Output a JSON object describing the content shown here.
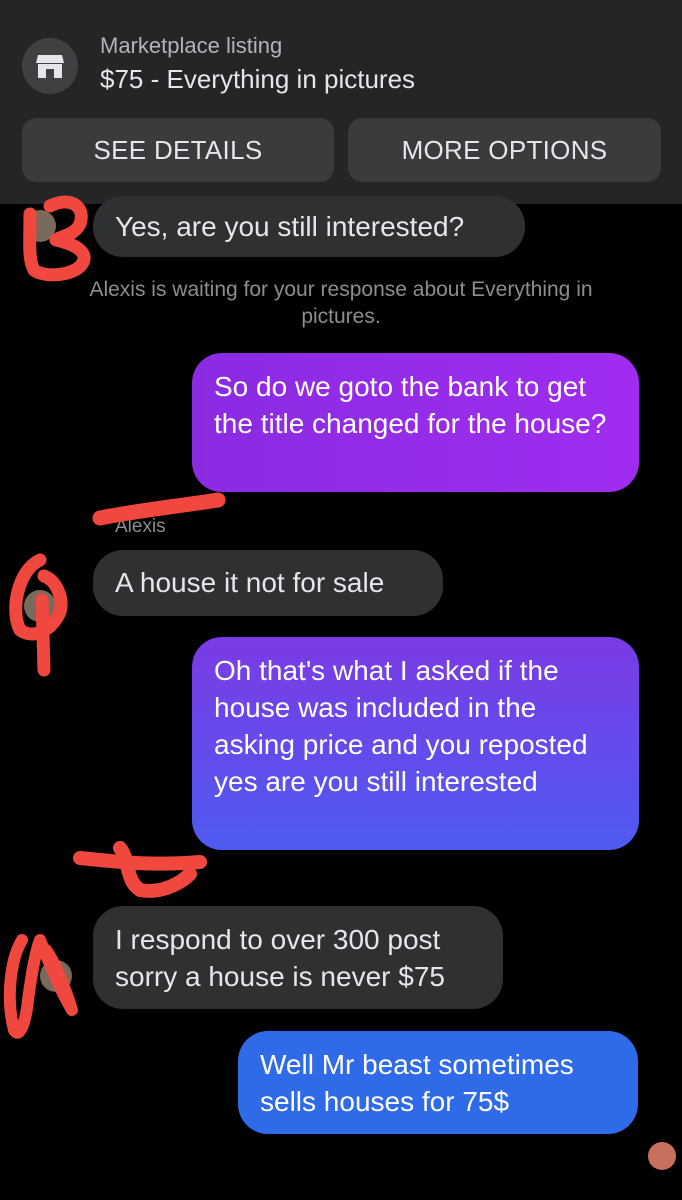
{
  "listing": {
    "label": "Marketplace listing",
    "title": "$75 - Everything in pictures",
    "icon": "store-icon"
  },
  "buttons": {
    "see_details": "SEE DETAILS",
    "more_options": "MORE OPTIONS"
  },
  "system_note": "Alexis is waiting for your response about Everything in pictures.",
  "sender_name": "Alexis",
  "messages": [
    {
      "direction": "incoming",
      "text": "Yes, are you still interested?"
    },
    {
      "direction": "outgoing",
      "text": "So do we goto the bank to get the title changed for the house?"
    },
    {
      "direction": "incoming",
      "text": "A house it not for sale"
    },
    {
      "direction": "outgoing",
      "text": "Oh that's what I asked if the house was included in the asking price and you reposted yes are you still interested"
    },
    {
      "direction": "incoming",
      "text": "I respond to over 300 post sorry a house is never $75"
    },
    {
      "direction": "outgoing",
      "text": "Well Mr beast sometimes sells houses for 75$"
    }
  ],
  "colors": {
    "topbar": "#242526",
    "incoming_bubble": "#2f3031",
    "outgoing_gradient_1": [
      "#8a2be2",
      "#a02cf0"
    ],
    "outgoing_gradient_2": [
      "#7b3ae6",
      "#4f5bf0"
    ],
    "outgoing_gradient_3": "#2f6be8",
    "scribble": "#f0473f"
  }
}
